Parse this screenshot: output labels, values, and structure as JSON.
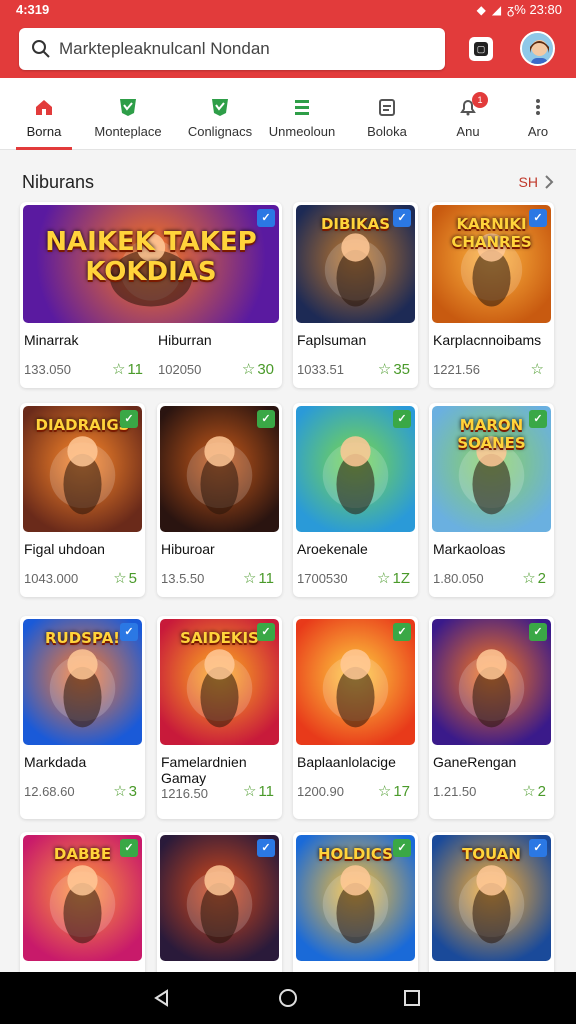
{
  "status": {
    "time": "4:319",
    "battery": "ᵹ% 23:80"
  },
  "search": {
    "value": "Marktepleaknulcanl Nondan"
  },
  "tabs": [
    {
      "label": "Borna",
      "icon": "home-icon",
      "color": "#e23b3b"
    },
    {
      "label": "Monteplace",
      "icon": "tag-icon",
      "color": "#2e9e48"
    },
    {
      "label": "Conlignacs",
      "icon": "tag-icon",
      "color": "#2e9e48"
    },
    {
      "label": "Unmeoloun",
      "icon": "menu-lines-icon",
      "color": "#2e9e48"
    },
    {
      "label": "Boloka",
      "icon": "calendar-icon",
      "color": "#555555"
    },
    {
      "label": "Anu",
      "icon": "bell-icon",
      "color": "#555555",
      "badge": "1"
    },
    {
      "label": "Aro",
      "icon": "more-vertical-icon",
      "color": "#555555"
    }
  ],
  "section": {
    "title": "Niburans",
    "more": "SH"
  },
  "cards": [
    {
      "name": "Minarrak",
      "price": "133.050",
      "rating": "11",
      "art_title": "NAIKEK TAKEP KOKDIAS",
      "c1": "#5a1aa0",
      "c2": "#ff7a1a",
      "badge": "#2b78e4"
    },
    {
      "name": "Hiburran",
      "price": "102050",
      "rating": "30"
    },
    {
      "name": "Faplsuman",
      "price": "1033.51",
      "rating": "35",
      "art_title": "DIBIKAS",
      "c1": "#1d2a55",
      "c2": "#c47a2a",
      "badge": "#2b78e4"
    },
    {
      "name": "Karplacnnoibams",
      "price": "1221.56",
      "rating": "",
      "art_title": "KARNIKI CHANRES",
      "c1": "#c85a10",
      "c2": "#ffb640",
      "badge": "#2b78e4"
    },
    {
      "name": "Figal uhdoan",
      "price": "1043.000",
      "rating": "5",
      "art_title": "DIADRAIGS",
      "c1": "#6a2a1a",
      "c2": "#ff8a2a",
      "badge": "#3aa846"
    },
    {
      "name": "Hiburoar",
      "price": "13.5.50",
      "rating": "11",
      "art_title": "",
      "c1": "#2a1410",
      "c2": "#c85a1a",
      "badge": "#3aa846"
    },
    {
      "name": "Aroekenale",
      "price": "1700530",
      "rating": "1Z",
      "art_title": "",
      "c1": "#2a9ad8",
      "c2": "#7ad84a",
      "badge": "#3aa846"
    },
    {
      "name": "Markaoloas",
      "price": "1.80.050",
      "rating": "2",
      "art_title": "MARON SOANES",
      "c1": "#6ab0e0",
      "c2": "#8ad060",
      "badge": "#3aa846"
    },
    {
      "name": "Markdada",
      "price": "12.68.60",
      "rating": "3",
      "art_title": "RUDSPA!",
      "c1": "#1a5ad8",
      "c2": "#ff7a2a",
      "badge": "#2b78e4"
    },
    {
      "name": "Famelardnien Gamay",
      "price": "1216.50",
      "rating": "11",
      "art_title": "SAIDEKIS",
      "c1": "#c81a3a",
      "c2": "#ffb020",
      "badge": "#3aa846"
    },
    {
      "name": "Baplaanlolacige",
      "price": "1200.90",
      "rating": "17",
      "art_title": "",
      "c1": "#e83a1a",
      "c2": "#ffd040",
      "badge": "#3aa846"
    },
    {
      "name": "GaneRengan",
      "price": "1.21.50",
      "rating": "2",
      "art_title": "",
      "c1": "#3a1a8a",
      "c2": "#ff7a1a",
      "badge": "#3aa846"
    },
    {
      "name": "",
      "price": "",
      "rating": "",
      "art_title": "DABBE",
      "c1": "#c81a6a",
      "c2": "#ff9a3a",
      "badge": "#3aa846"
    },
    {
      "name": "",
      "price": "",
      "rating": "",
      "art_title": "",
      "c1": "#2a1a3a",
      "c2": "#d84a1a",
      "badge": "#2b78e4"
    },
    {
      "name": "",
      "price": "",
      "rating": "",
      "art_title": "HOLDICS",
      "c1": "#1a6ad8",
      "c2": "#ffc030",
      "badge": "#3aa846"
    },
    {
      "name": "",
      "price": "",
      "rating": "",
      "art_title": "TOUAN",
      "c1": "#1a4a9a",
      "c2": "#ffb030",
      "badge": "#2b78e4"
    }
  ]
}
